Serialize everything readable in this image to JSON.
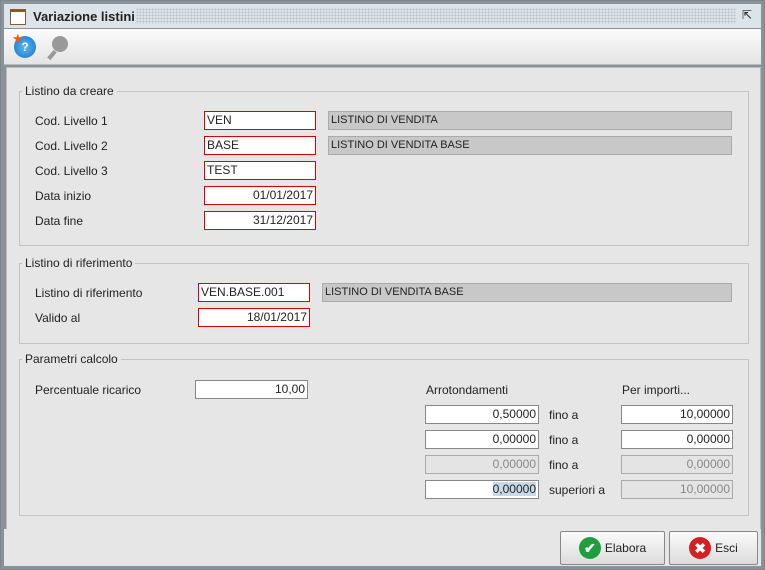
{
  "window": {
    "title": "Variazione listini"
  },
  "fs1": {
    "legend": "Listino da creare",
    "liv1_label": "Cod. Livello 1",
    "liv1": "VEN",
    "liv1_desc": "LISTINO DI VENDITA",
    "liv2_label": "Cod. Livello 2",
    "liv2": "BASE",
    "liv2_desc": "LISTINO DI VENDITA BASE",
    "liv3_label": "Cod. Livello 3",
    "liv3": "TEST",
    "inizio_label": "Data inizio",
    "inizio": "01/01/2017",
    "fine_label": "Data fine",
    "fine": "31/12/2017"
  },
  "fs2": {
    "legend": "Listino di riferimento",
    "rif_label": "Listino di riferimento",
    "rif": "VEN.BASE.001",
    "rif_desc": "LISTINO DI VENDITA BASE",
    "valido_label": "Valido al",
    "valido": "18/01/2017"
  },
  "fs3": {
    "legend": "Parametri calcolo",
    "perc_label": "Percentuale ricarico",
    "perc": "10,00",
    "arr_header": "Arrotondamenti",
    "imp_header": "Per importi...",
    "rows": [
      {
        "arr": "0,50000",
        "mid": "fino a",
        "imp": "10,00000"
      },
      {
        "arr": "0,00000",
        "mid": "fino a",
        "imp": "0,00000"
      },
      {
        "arr": "0,00000",
        "mid": "fino a",
        "imp": "0,00000"
      },
      {
        "arr": "0,00000",
        "mid": "superiori a",
        "imp": "10,00000"
      }
    ]
  },
  "buttons": {
    "elabora": "Elabora",
    "esci": "Esci"
  }
}
